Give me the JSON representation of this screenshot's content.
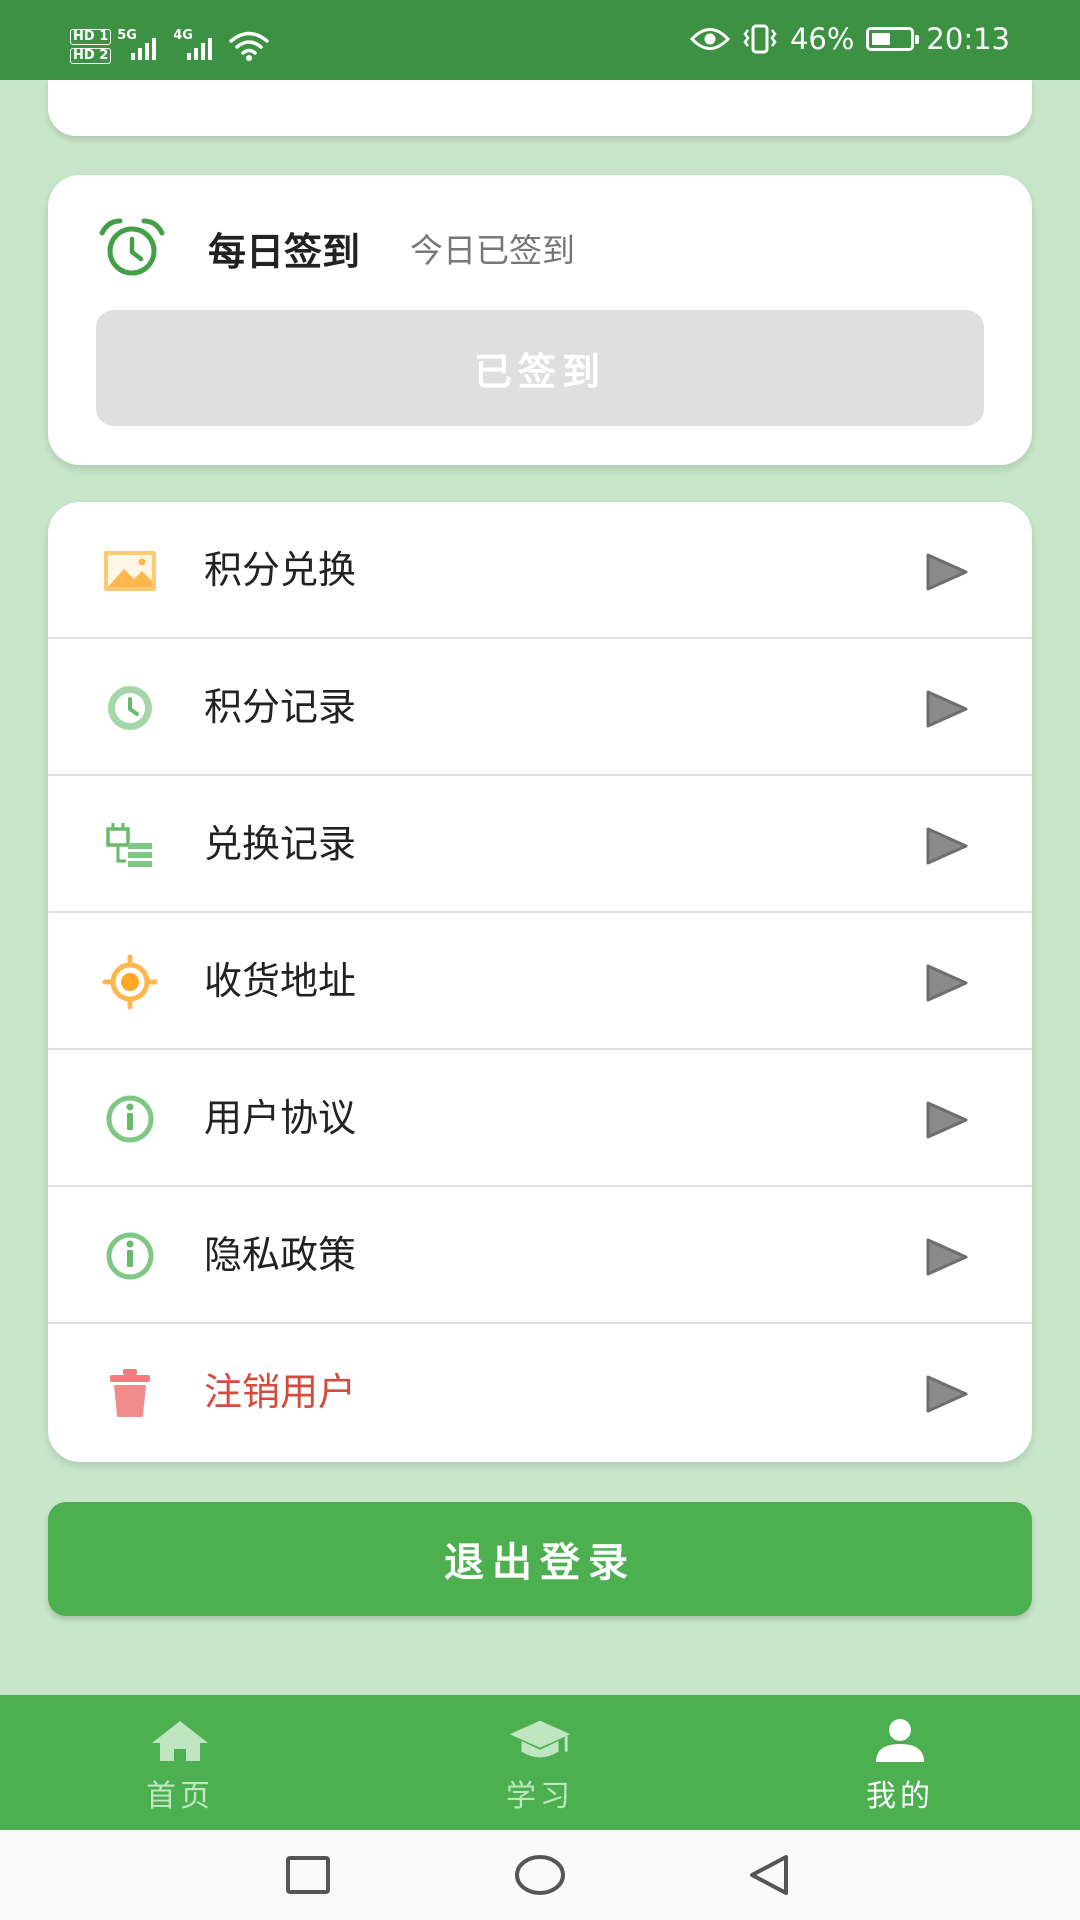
{
  "status_bar": {
    "sim1": "HD",
    "sim1_slot": "1",
    "sim2": "HD",
    "sim2_slot": "2",
    "net1": "5G",
    "net2": "4G",
    "battery_percent": "46%",
    "battery_level": 0.46,
    "time": "20:13",
    "icons": [
      "hd-icon",
      "signal-icon",
      "wifi-icon",
      "eye-icon",
      "vibrate-icon",
      "battery-icon"
    ]
  },
  "checkin": {
    "title": "每日签到",
    "status": "今日已签到",
    "button_label": "已签到",
    "icon": "alarm-clock-icon"
  },
  "menu": {
    "items": [
      {
        "label": "积分兑换",
        "icon": "image-icon"
      },
      {
        "label": "积分记录",
        "icon": "clock-icon"
      },
      {
        "label": "兑换记录",
        "icon": "list-icon"
      },
      {
        "label": "收货地址",
        "icon": "location-icon"
      },
      {
        "label": "用户协议",
        "icon": "info-icon"
      },
      {
        "label": "隐私政策",
        "icon": "info-icon"
      },
      {
        "label": "注销用户",
        "icon": "trash-icon"
      }
    ]
  },
  "logout": {
    "label": "退出登录"
  },
  "bottom_nav": {
    "items": [
      {
        "label": "首页",
        "icon": "home-icon"
      },
      {
        "label": "学习",
        "icon": "graduation-cap-icon"
      },
      {
        "label": "我的",
        "icon": "user-icon"
      }
    ],
    "active_index": 2
  },
  "colors": {
    "accent": "#4caf50",
    "status_bar": "#3d9142",
    "background": "#c8e6c9",
    "danger": "#d24b3e"
  }
}
